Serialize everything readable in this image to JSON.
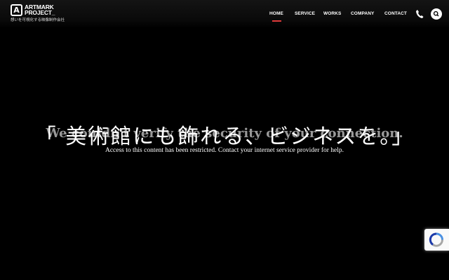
{
  "header": {
    "logo": {
      "line1": "ARTMARK",
      "line2": "PROJECT_",
      "tagline": "想いを可視化する映像制作会社",
      "mark": "A"
    },
    "nav": [
      {
        "id": "home",
        "label": "HOME",
        "active": true
      },
      {
        "id": "service",
        "label": "SERVICE",
        "active": false
      },
      {
        "id": "works",
        "label": "WORKS",
        "active": false
      },
      {
        "id": "company",
        "label": "COMPANY",
        "active": false
      },
      {
        "id": "contact",
        "label": "CONTACT",
        "active": false
      }
    ],
    "icons": {
      "phone": "phone-icon",
      "search": "search-icon"
    },
    "accent_color": "#e03a3a"
  },
  "hero": {
    "quote": "「 美術館にも飾れる、ビジネスを。」"
  },
  "overlay": {
    "title": "We couldn't verify the security of your connection.",
    "message": "Access to this content has been restricted. Contact your internet service provider for help."
  },
  "recaptcha": {
    "icon": "recaptcha-icon"
  }
}
